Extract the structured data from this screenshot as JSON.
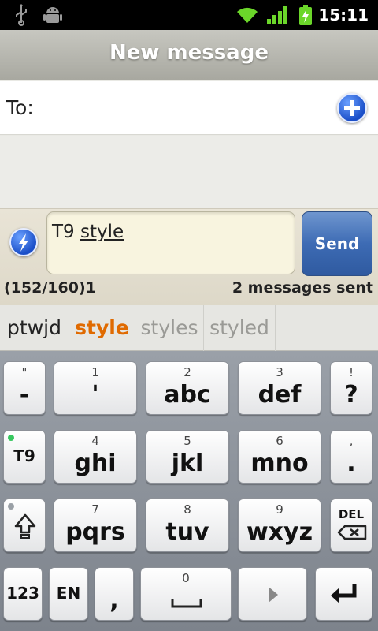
{
  "status_bar": {
    "time": "15:11",
    "icons": [
      "usb-icon",
      "android-debug-icon",
      "wifi-icon",
      "signal-icon",
      "battery-charging-icon"
    ]
  },
  "header": {
    "title": "New message"
  },
  "recipient": {
    "label": "To:",
    "value": ""
  },
  "compose": {
    "typed_prefix": "T9 ",
    "typed_word": "style",
    "send_label": "Send",
    "counter": "(152/160)1",
    "sent_status": "2 messages sent"
  },
  "suggestions": [
    {
      "text": "ptwjd"
    },
    {
      "text": "style"
    },
    {
      "text": "styles"
    },
    {
      "text": "styled"
    }
  ],
  "keyboard": {
    "keys": {
      "punct": {
        "top": "\"",
        "main": "-"
      },
      "k1": {
        "num": "1",
        "main": "'"
      },
      "k2": {
        "num": "2",
        "main": "abc"
      },
      "k3": {
        "num": "3",
        "main": "def"
      },
      "question": {
        "top": "!",
        "main": "?"
      },
      "t9": {
        "main": "T9"
      },
      "k4": {
        "num": "4",
        "main": "ghi"
      },
      "k5": {
        "num": "5",
        "main": "jkl"
      },
      "k6": {
        "num": "6",
        "main": "mno"
      },
      "period": {
        "top": ",",
        "main": "."
      },
      "shift": {
        "main": ""
      },
      "k7": {
        "num": "7",
        "main": "pqrs"
      },
      "k8": {
        "num": "8",
        "main": "tuv"
      },
      "k9": {
        "num": "9",
        "main": "wxyz"
      },
      "del": {
        "main": "DEL"
      },
      "mode123": {
        "main": "123"
      },
      "lang": {
        "main": "EN"
      },
      "comma": {
        "main": ","
      },
      "k0": {
        "num": "0"
      },
      "arrow": {},
      "enter": {}
    }
  },
  "colors": {
    "accent_orange": "#e06a00",
    "send_blue": "#3d6bb4",
    "t9_indicator": "#36c75e"
  }
}
